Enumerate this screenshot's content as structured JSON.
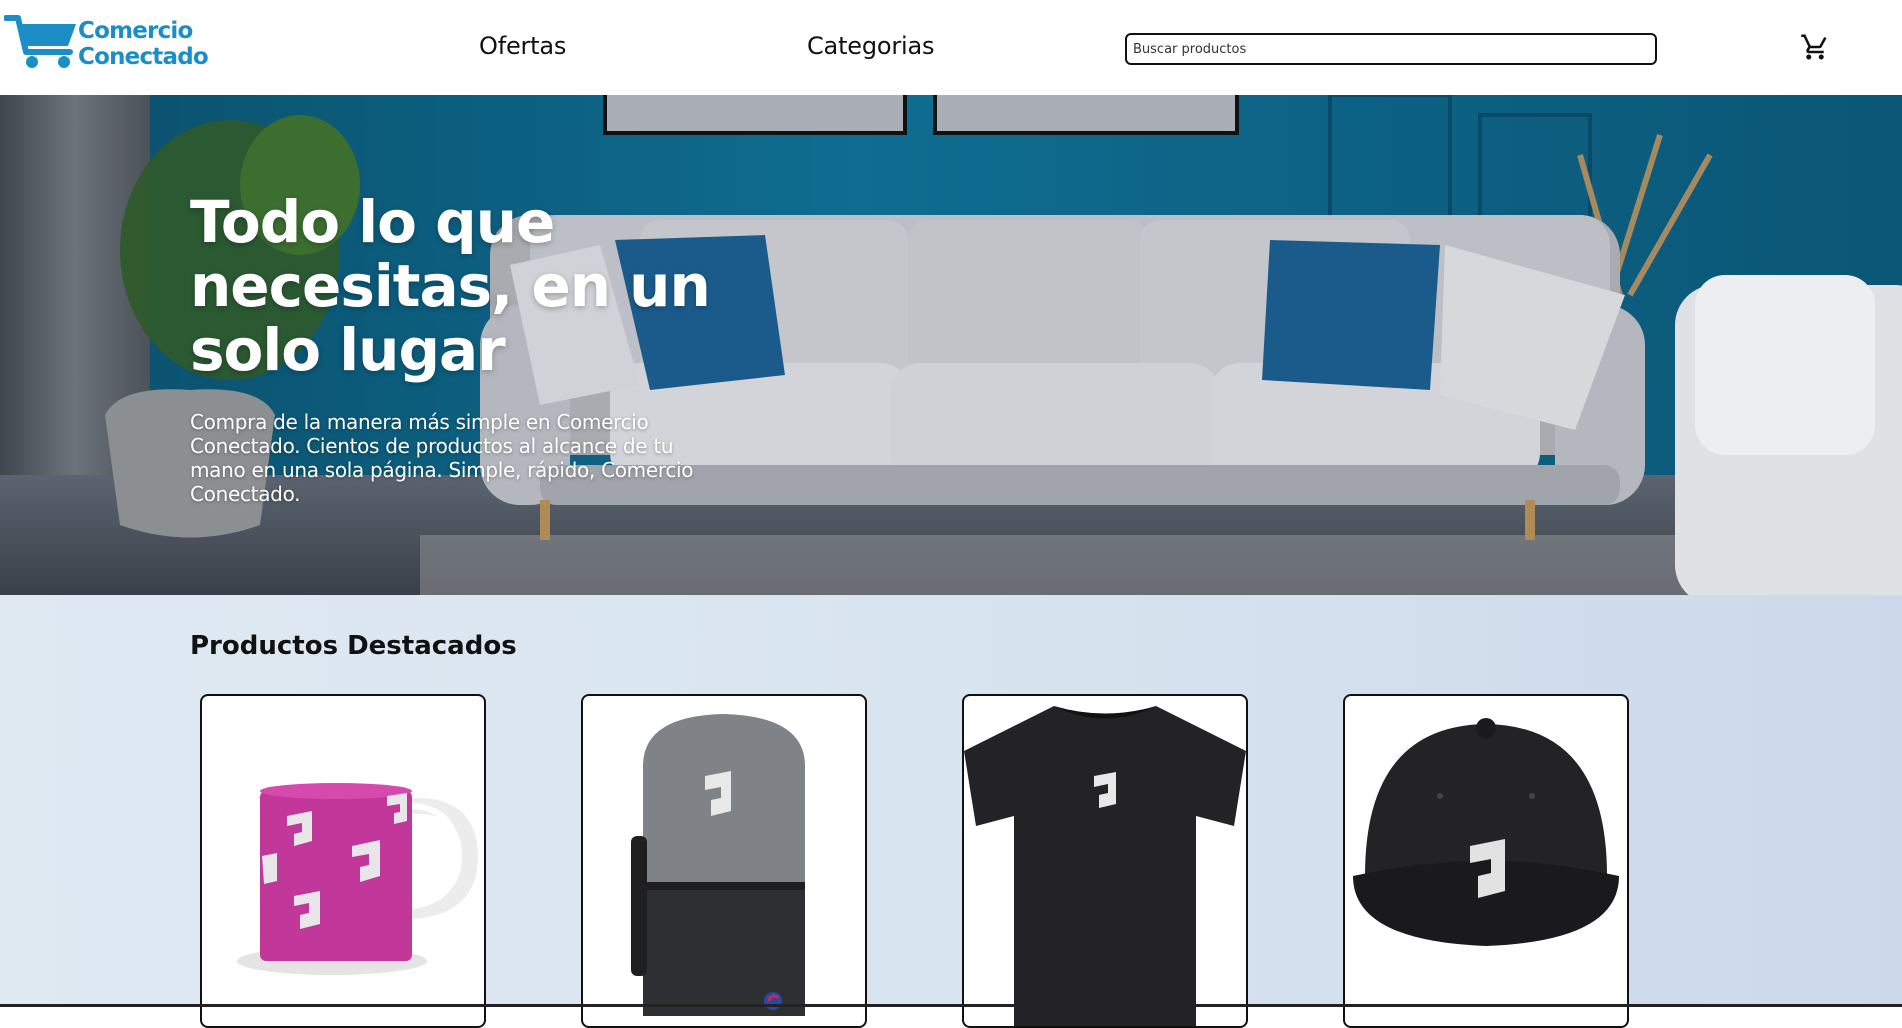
{
  "header": {
    "logo": {
      "line1": "Comercio",
      "line2": "Conectado",
      "icon": "shopping-cart-logo-icon"
    },
    "nav": [
      {
        "label": "Ofertas"
      },
      {
        "label": "Categorias"
      }
    ],
    "search": {
      "placeholder": "Buscar productos",
      "value": ""
    },
    "cart_icon": "shopping-cart-icon"
  },
  "hero": {
    "title": "Todo lo que necesitas, en un solo lugar",
    "subtitle": "Compra de la manera más simple en Comercio Conectado. Cientos de productos al alcance de tu mano en una sola página. Simple, rápido, Comercio Conectado."
  },
  "featured": {
    "title": "Productos Destacados",
    "products": [
      {
        "image": "magenta-mug"
      },
      {
        "image": "gray-black-backpack"
      },
      {
        "image": "black-t-shirt"
      },
      {
        "image": "black-snapback-cap"
      }
    ]
  },
  "colors": {
    "brand": "#1b8fc5",
    "hero_wall": "#0d5f80",
    "featured_bg": "#d8e4ef",
    "text": "#111111"
  }
}
